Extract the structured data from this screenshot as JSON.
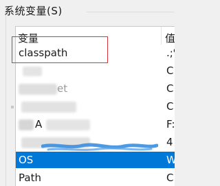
{
  "group": {
    "title": "系统变量(S)"
  },
  "list": {
    "columns": {
      "name": "变量",
      "value": "值"
    },
    "rows": [
      {
        "name": "classpath",
        "value": ".;%"
      },
      {
        "name": "",
        "value": "C"
      },
      {
        "name": "et",
        "value": "C"
      },
      {
        "name": "",
        "value": "C"
      },
      {
        "name": "A",
        "value": "F:"
      },
      {
        "name": "",
        "value": "4"
      },
      {
        "name": "OS",
        "value": "W",
        "selected": true
      },
      {
        "name": "Path",
        "value": "C"
      }
    ]
  },
  "colors": {
    "selection": "#0078d7",
    "annotation_box": "#e0323a"
  }
}
